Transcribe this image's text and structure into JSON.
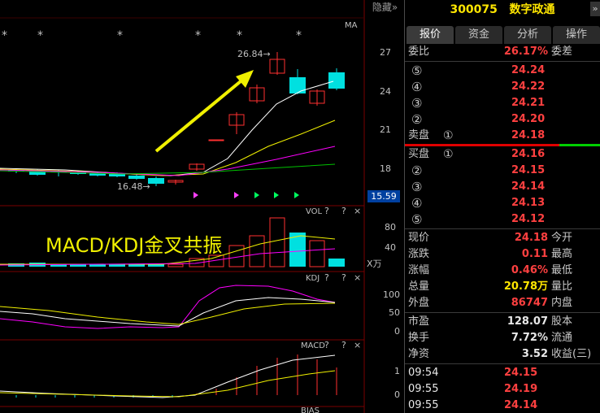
{
  "chart": {
    "hide_label": "隐藏»",
    "ma_label": "MA",
    "stars": [
      "*",
      "*",
      "*",
      "*",
      "*",
      "*",
      "*"
    ],
    "high_annotation": "26.84→",
    "low_annotation": "16.48→",
    "price_axis": [
      "27",
      "24",
      "21",
      "18"
    ],
    "current_price_tag": "15.59",
    "overlay_text": "MACD/KDJ金叉共振",
    "vol_label": "VOL",
    "vol_axis": [
      "80",
      "40"
    ],
    "vol_unit": "X万",
    "kdj_label": "KDJ",
    "kdj_axis": [
      "100",
      "50",
      "0"
    ],
    "macd_label": "MACD",
    "macd_axis": [
      "1",
      "0"
    ],
    "bias_label": "BIAS",
    "help_icon_text": "?",
    "close_icon_text": "×",
    "colors": {
      "up": "#ff3030",
      "down": "#00e0e0",
      "arrow": "#f0f000",
      "ma5": "#ffffff",
      "ma10": "#f0f000",
      "ma20": "#ff00ff",
      "ma60": "#00c000"
    }
  },
  "quote": {
    "code": "300075",
    "name": "数字政通",
    "tabs": [
      "报价",
      "资金",
      "分析",
      "操作"
    ],
    "weibi_label": "委比",
    "weibi_value": "26.17%",
    "weicha_label": "委差",
    "asks": [
      {
        "idx": "⑤",
        "price": "24.24"
      },
      {
        "idx": "④",
        "price": "24.22"
      },
      {
        "idx": "③",
        "price": "24.21"
      },
      {
        "idx": "②",
        "price": "24.20"
      },
      {
        "idx": "①",
        "price": "24.18",
        "side": "卖盘"
      }
    ],
    "bids": [
      {
        "idx": "①",
        "price": "24.16",
        "side": "买盘"
      },
      {
        "idx": "②",
        "price": "24.15"
      },
      {
        "idx": "③",
        "price": "24.14"
      },
      {
        "idx": "④",
        "price": "24.13"
      },
      {
        "idx": "⑤",
        "price": "24.12"
      }
    ],
    "stats": [
      {
        "l": "现价",
        "v": "24.18",
        "c": "red",
        "r": "今开"
      },
      {
        "l": "涨跌",
        "v": "0.11",
        "c": "red",
        "r": "最高"
      },
      {
        "l": "涨幅",
        "v": "0.46%",
        "c": "red",
        "r": "最低"
      },
      {
        "l": "总量",
        "v": "20.78万",
        "c": "yellow",
        "r": "量比"
      },
      {
        "l": "外盘",
        "v": "86747",
        "c": "red",
        "r": "内盘"
      },
      {
        "l": "市盈",
        "v": "128.07",
        "c": "white",
        "r": "股本"
      },
      {
        "l": "换手",
        "v": "7.72%",
        "c": "white",
        "r": "流通"
      },
      {
        "l": "净资",
        "v": "3.52",
        "c": "white",
        "r": "收益(三)"
      }
    ],
    "ticks": [
      {
        "t": "09:54",
        "p": "24.15"
      },
      {
        "t": "09:55",
        "p": "24.19"
      },
      {
        "t": "09:55",
        "p": "24.14"
      }
    ]
  }
}
